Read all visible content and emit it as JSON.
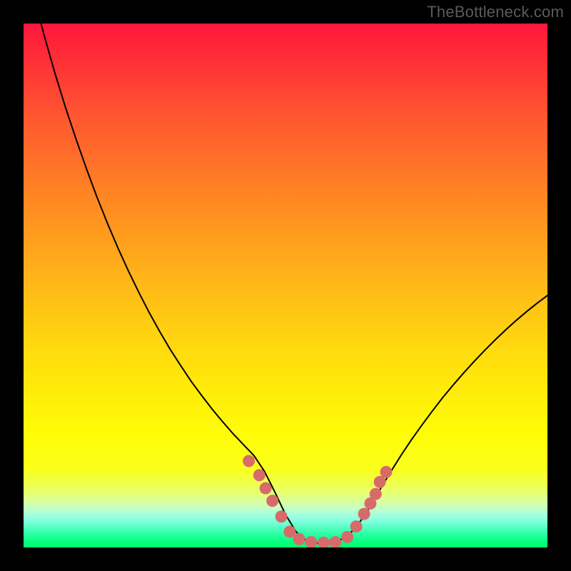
{
  "watermark": "TheBottleneck.com",
  "colors": {
    "frame": "#000000",
    "curve_stroke": "#000000",
    "marker_fill": "#d76b6b",
    "gradient_top": "#ff163f",
    "gradient_bottom": "#00ff6e"
  },
  "chart_data": {
    "type": "line",
    "title": "",
    "xlabel": "",
    "ylabel": "",
    "xlim": [
      0,
      100
    ],
    "ylim": [
      0,
      100
    ],
    "grid": false,
    "legend": false,
    "x": [
      0,
      2,
      4,
      6,
      8,
      10,
      12,
      14,
      16,
      18,
      20,
      22,
      24,
      26,
      28,
      30,
      32,
      34,
      36,
      38,
      40,
      42,
      44,
      46,
      48,
      50,
      52,
      54,
      56,
      58,
      60,
      62,
      64,
      66,
      68,
      70,
      72,
      74,
      76,
      78,
      80,
      82,
      84,
      86,
      88,
      90,
      92,
      94,
      96,
      98,
      100
    ],
    "y": [
      113,
      105,
      97.5,
      90.5,
      84,
      78,
      72.3,
      66.9,
      61.9,
      57.2,
      52.8,
      48.7,
      44.8,
      41.2,
      37.8,
      34.7,
      31.7,
      29,
      26.4,
      24,
      21.7,
      19.6,
      17.5,
      14.5,
      10.5,
      6.3,
      3,
      1.3,
      0.8,
      0.9,
      1.2,
      2.3,
      4.6,
      7.5,
      11,
      14.3,
      17.5,
      20.5,
      23.3,
      26,
      28.6,
      31,
      33.3,
      35.5,
      37.6,
      39.6,
      41.5,
      43.3,
      45,
      46.6,
      48.1
    ],
    "markers": [
      {
        "x": 43,
        "y": 16.5
      },
      {
        "x": 45,
        "y": 13.8
      },
      {
        "x": 46.2,
        "y": 11.3
      },
      {
        "x": 47.5,
        "y": 8.9
      },
      {
        "x": 49.2,
        "y": 5.9
      },
      {
        "x": 50.8,
        "y": 3.0
      },
      {
        "x": 52.6,
        "y": 1.6
      },
      {
        "x": 54.9,
        "y": 1.0
      },
      {
        "x": 57.3,
        "y": 0.9
      },
      {
        "x": 59.5,
        "y": 1.0
      },
      {
        "x": 61.8,
        "y": 2.0
      },
      {
        "x": 63.5,
        "y": 4.0
      },
      {
        "x": 65.0,
        "y": 6.4
      },
      {
        "x": 66.2,
        "y": 8.4
      },
      {
        "x": 67.2,
        "y": 10.2
      },
      {
        "x": 68.0,
        "y": 12.5
      },
      {
        "x": 69.2,
        "y": 14.4
      }
    ]
  }
}
